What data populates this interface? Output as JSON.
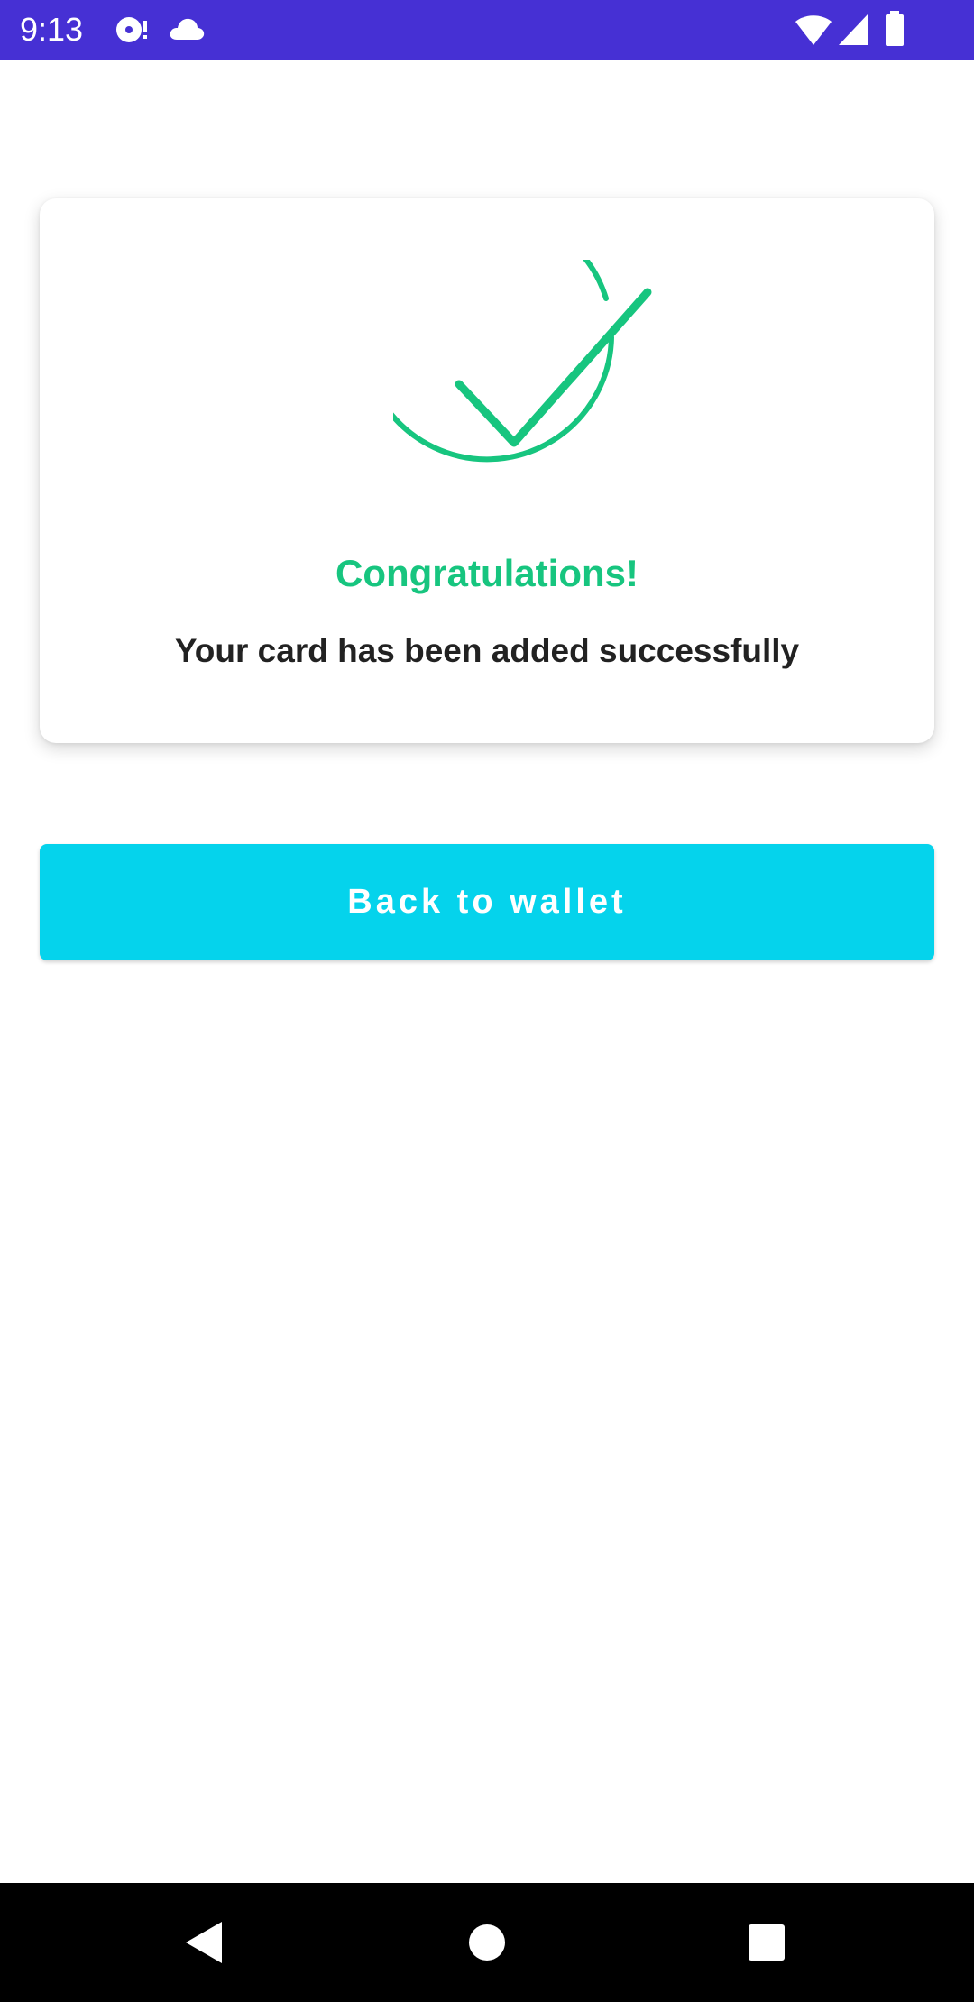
{
  "status_bar": {
    "time": "9:13",
    "background_color": "#4630d4",
    "left_icons": [
      "media-icon",
      "cloud-icon"
    ],
    "right_icons": [
      "wifi-icon",
      "cellular-signal-icon",
      "battery-icon"
    ]
  },
  "card": {
    "icon": "check-circle-icon",
    "icon_color": "#17c57f",
    "title": "Congratulations!",
    "message": "Your card has been added successfully"
  },
  "primary_action": {
    "label": "Back to wallet",
    "color": "#05d3ec"
  },
  "nav_bar": {
    "buttons": [
      "back-icon",
      "home-icon",
      "recents-icon"
    ]
  }
}
